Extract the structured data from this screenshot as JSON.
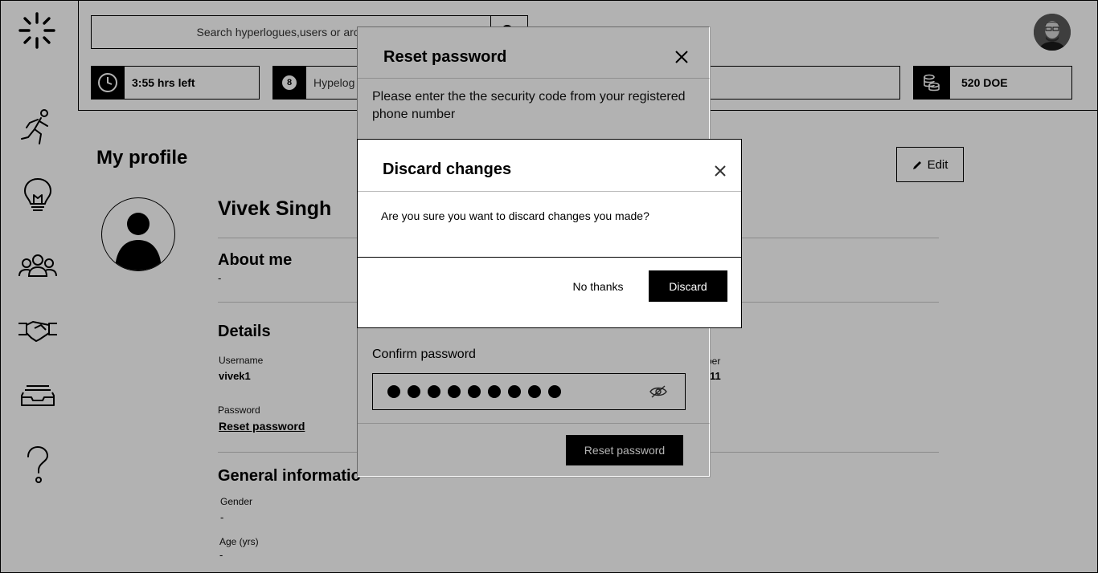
{
  "header": {
    "search_placeholder": "Search hyperlogues,users or archives",
    "time_left": "3:55 hrs left",
    "hyperlogue_count": "8",
    "hyperlogue_label": "Hypelog",
    "doe_balance": "520 DOE"
  },
  "sidebar": {
    "items": [
      "runner-icon",
      "lightbulb-icon",
      "people-icon",
      "handshake-icon",
      "inbox-icon",
      "help-icon"
    ]
  },
  "profile": {
    "page_title": "My profile",
    "edit_label": "Edit",
    "name": "Vivek Singh",
    "about_heading": "About me",
    "about_value": "-",
    "details_heading": "Details",
    "username_label": "Username",
    "username_value": "vivek1",
    "password_label": "Password",
    "reset_link": "Reset password",
    "phone_label_fragment": "ber",
    "phone_value_fragment": "11",
    "general_heading": "General informatio",
    "gender_label": "Gender",
    "gender_value": "-",
    "age_label": "Age (yrs)",
    "age_value": "-"
  },
  "reset_modal": {
    "title": "Reset password",
    "description": "Please enter the the security code from your registered phone number",
    "confirm_label": "Confirm password",
    "submit_label": "Reset password"
  },
  "discard_modal": {
    "title": "Discard changes",
    "message": "Are you sure you want to discard changes you made?",
    "cancel_label": "No thanks",
    "confirm_label": "Discard"
  },
  "colors": {
    "overlay": "rgba(0,0,0,0.3)",
    "primary": "#000000"
  }
}
